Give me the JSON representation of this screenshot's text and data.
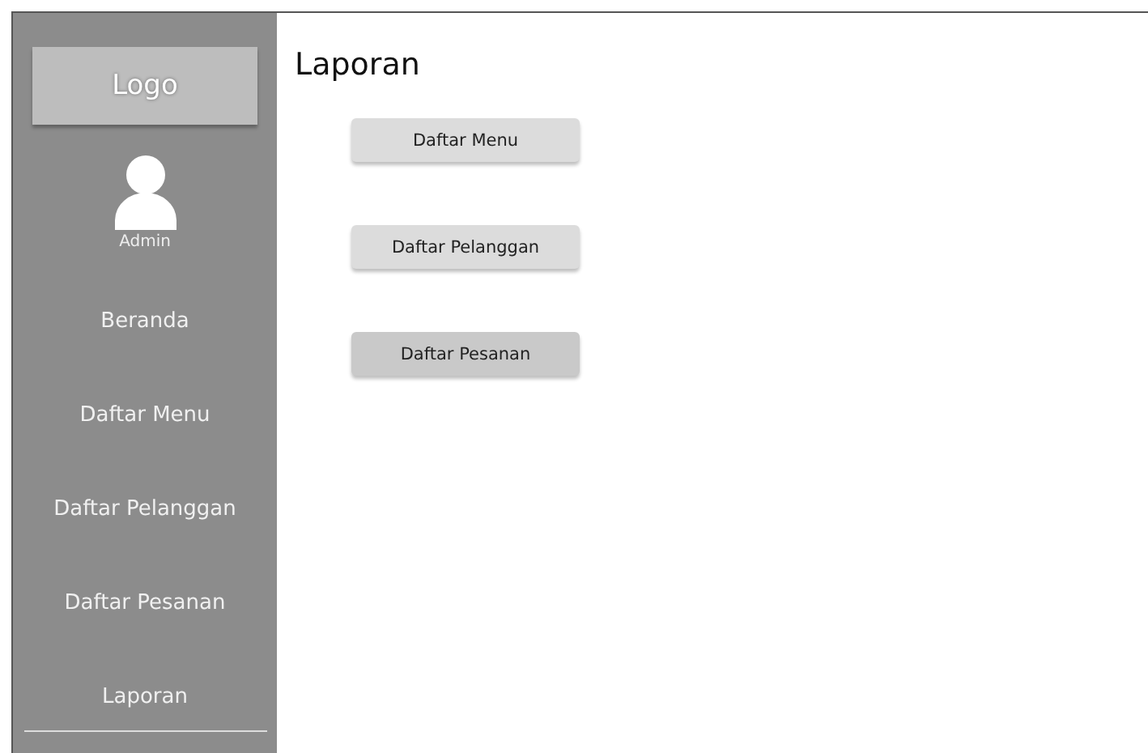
{
  "sidebar": {
    "logo": "Logo",
    "user": {
      "name": "Admin"
    },
    "items": [
      {
        "label": "Beranda",
        "selected": false
      },
      {
        "label": "Daftar Menu",
        "selected": false
      },
      {
        "label": "Daftar Pelanggan",
        "selected": false
      },
      {
        "label": "Daftar Pesanan",
        "selected": false
      },
      {
        "label": "Laporan",
        "selected": true
      }
    ]
  },
  "main": {
    "title": "Laporan",
    "buttons": [
      {
        "label": "Daftar Menu",
        "selected": false
      },
      {
        "label": "Daftar Pelanggan",
        "selected": false
      },
      {
        "label": "Daftar Pesanan",
        "selected": true
      }
    ]
  }
}
